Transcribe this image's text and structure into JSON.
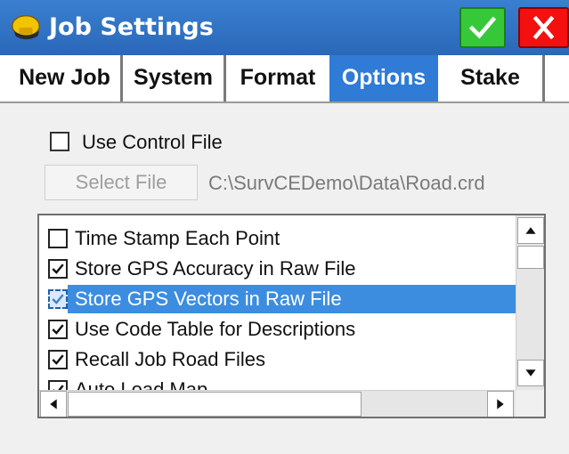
{
  "window": {
    "title": "Job Settings",
    "icon": "helmet-icon",
    "ok_icon": "check-icon",
    "close_icon": "close-icon",
    "colors": {
      "titlebar": "#2f74c9",
      "ok": "#37c83a",
      "close": "#f41010",
      "selection": "#3c8de0"
    }
  },
  "tabs": [
    {
      "label": "New Job",
      "active": false
    },
    {
      "label": "System",
      "active": false
    },
    {
      "label": "Format",
      "active": false
    },
    {
      "label": "Options",
      "active": true
    },
    {
      "label": "Stake",
      "active": false
    }
  ],
  "options": {
    "use_control_file": {
      "label": "Use Control File",
      "checked": false
    },
    "select_file": {
      "label": "Select File",
      "enabled": false
    },
    "file_path": "C:\\SurvCEDemo\\Data\\Road.crd"
  },
  "list": {
    "items": [
      {
        "label": "Time Stamp Each Point",
        "checked": false,
        "selected": false
      },
      {
        "label": "Store GPS Accuracy in Raw File",
        "checked": true,
        "selected": false
      },
      {
        "label": "Store GPS Vectors in Raw File",
        "checked": true,
        "selected": true
      },
      {
        "label": "Use Code Table for Descriptions",
        "checked": true,
        "selected": false
      },
      {
        "label": "Recall Job Road Files",
        "checked": true,
        "selected": false
      },
      {
        "label": "Auto Load Map",
        "checked": true,
        "selected": false
      }
    ]
  }
}
